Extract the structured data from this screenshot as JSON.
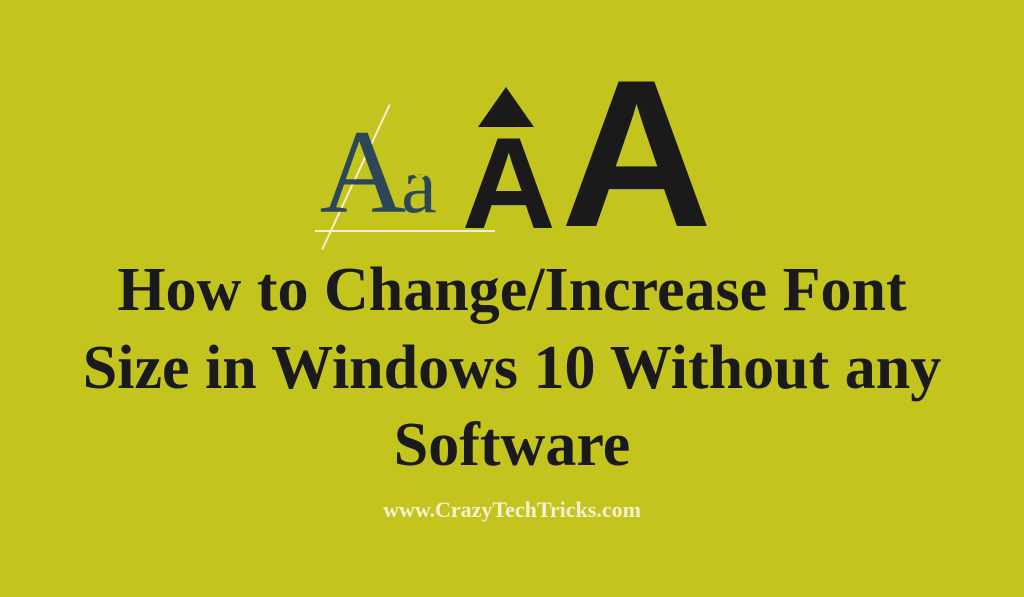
{
  "graphic": {
    "serif_capital": "A",
    "serif_lowercase": "a",
    "bold_A_small": "A",
    "bold_A_large": "A"
  },
  "headline": "How to Change/Increase Font Size in Windows 10 Without any Software",
  "website": "www.CrazyTechTricks.com",
  "colors": {
    "background": "#c4c41e",
    "text_dark": "#1a1a1a",
    "text_accent": "#2c4858",
    "line_light": "#f5f0d0"
  }
}
